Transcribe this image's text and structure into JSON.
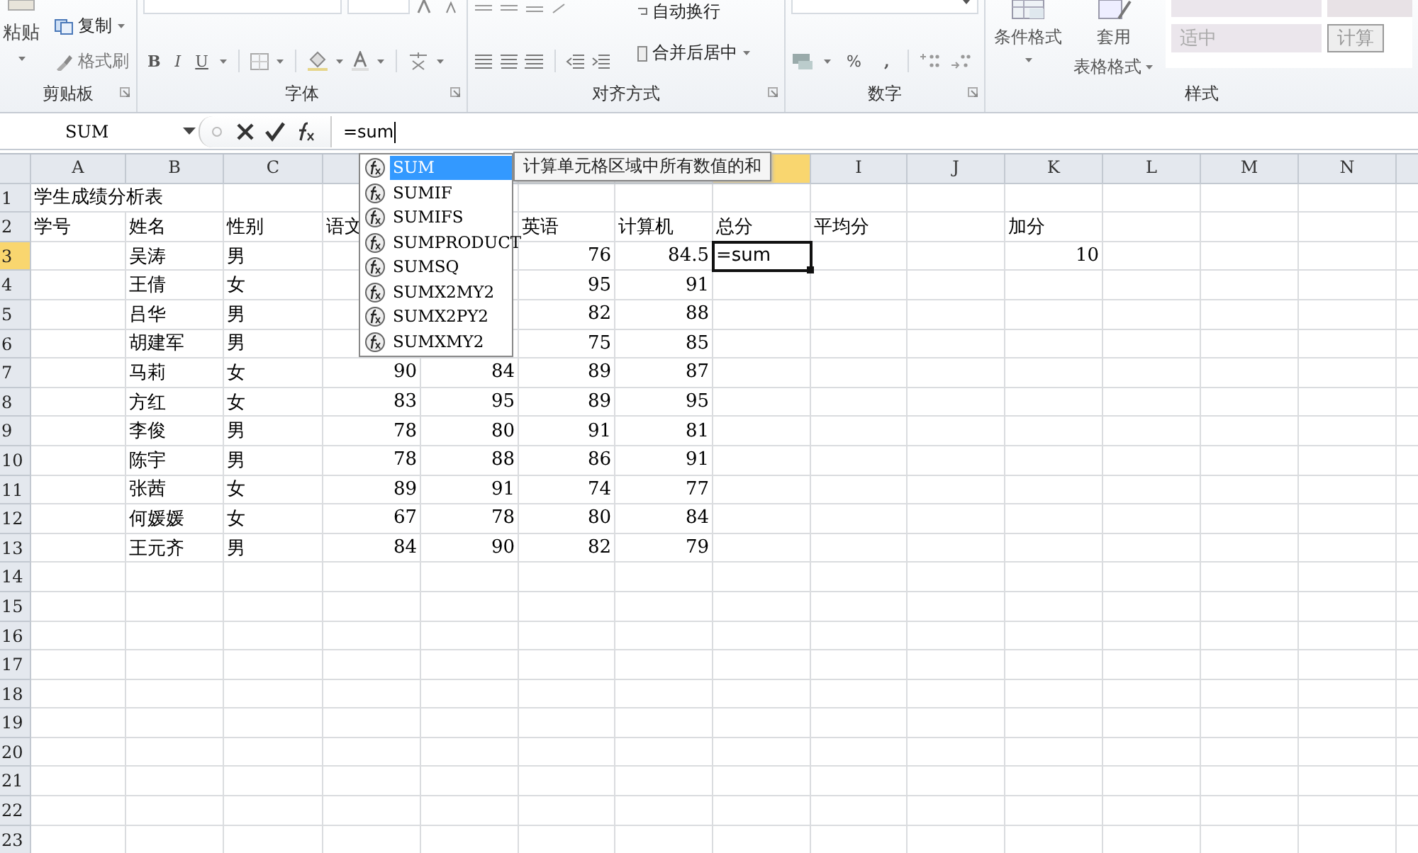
{
  "ribbon": {
    "clipboard": {
      "paste": "粘贴",
      "copy": "复制",
      "format_painter": "格式刷",
      "label": "剪贴板"
    },
    "font": {
      "bold": "B",
      "italic": "I",
      "underline": "U",
      "label": "字体"
    },
    "alignment": {
      "wrap_text": "自动换行",
      "merge_center": "合并后居中",
      "label": "对齐方式"
    },
    "number": {
      "percent": "%",
      "comma": ",",
      "label": "数字"
    },
    "styles": {
      "conditional_format": "条件格式",
      "table_format": [
        "套用",
        "表格格式"
      ],
      "style_cells": [
        {
          "text": "适中",
          "kind": "neutral"
        },
        {
          "text": "计算",
          "kind": "calc"
        }
      ],
      "label": "样式"
    }
  },
  "formula_bar": {
    "name_box": "SUM",
    "formula": "=sum"
  },
  "columns": [
    {
      "label": "A",
      "selected": false
    },
    {
      "label": "B",
      "selected": false
    },
    {
      "label": "C",
      "selected": false
    },
    {
      "selected": false
    },
    {
      "selected": false
    },
    {
      "selected": false
    },
    {
      "selected": false
    },
    {
      "selected": true
    },
    {
      "label": "I",
      "selected": false
    },
    {
      "label": "J",
      "selected": false
    },
    {
      "label": "K",
      "selected": false
    },
    {
      "label": "L",
      "selected": false
    },
    {
      "label": "M",
      "selected": false
    },
    {
      "label": "N",
      "selected": false
    }
  ],
  "rows": [
    {
      "number": "1",
      "selected": false,
      "cells": {
        "a": {
          "text": "学生成绩分析表",
          "kind": "text",
          "selected": false
        }
      }
    },
    {
      "number": "2",
      "selected": false,
      "cells": {
        "a": {
          "text": "学号",
          "kind": "text",
          "selected": false
        },
        "b": {
          "text": "姓名",
          "kind": "text",
          "selected": false
        },
        "c": {
          "text": "性别",
          "kind": "text",
          "selected": false
        },
        "d": {
          "text": "语文",
          "kind": "text",
          "selected": false
        },
        "f": {
          "text": "英语",
          "kind": "text",
          "selected": false
        },
        "g": {
          "text": "计算机",
          "kind": "text",
          "selected": false
        },
        "h": {
          "text": "总分",
          "kind": "text",
          "selected": false
        },
        "i": {
          "text": "平均分",
          "kind": "text",
          "selected": false
        },
        "k": {
          "text": "加分",
          "kind": "text",
          "selected": false
        }
      }
    },
    {
      "number": "3",
      "selected": true,
      "cells": {
        "b": {
          "text": "吴涛",
          "kind": "text",
          "selected": false
        },
        "c": {
          "text": "男",
          "kind": "text",
          "selected": false
        },
        "f": {
          "text": "76",
          "kind": "number",
          "selected": false
        },
        "g": {
          "text": "84.5",
          "kind": "number",
          "selected": false
        },
        "h": {
          "text": "=sum",
          "kind": "text",
          "selected": true
        },
        "k": {
          "text": "10",
          "kind": "number",
          "selected": false
        }
      }
    },
    {
      "number": "4",
      "selected": false,
      "cells": {
        "b": {
          "text": "王倩",
          "kind": "text",
          "selected": false
        },
        "c": {
          "text": "女",
          "kind": "text",
          "selected": false
        },
        "f": {
          "text": "95",
          "kind": "number",
          "selected": false
        },
        "g": {
          "text": "91",
          "kind": "number",
          "selected": false
        }
      }
    },
    {
      "number": "5",
      "selected": false,
      "cells": {
        "b": {
          "text": "吕华",
          "kind": "text",
          "selected": false
        },
        "c": {
          "text": "男",
          "kind": "text",
          "selected": false
        },
        "f": {
          "text": "82",
          "kind": "number",
          "selected": false
        },
        "g": {
          "text": "88",
          "kind": "number",
          "selected": false
        }
      }
    },
    {
      "number": "6",
      "selected": false,
      "cells": {
        "b": {
          "text": "胡建军",
          "kind": "text",
          "selected": false
        },
        "c": {
          "text": "男",
          "kind": "text",
          "selected": false
        },
        "f": {
          "text": "75",
          "kind": "number",
          "selected": false
        },
        "g": {
          "text": "85",
          "kind": "number",
          "selected": false
        }
      }
    },
    {
      "number": "7",
      "selected": false,
      "cells": {
        "b": {
          "text": "马莉",
          "kind": "text",
          "selected": false
        },
        "c": {
          "text": "女",
          "kind": "text",
          "selected": false
        },
        "d": {
          "text": "90",
          "kind": "number",
          "selected": false
        },
        "e": {
          "text": "84",
          "kind": "number",
          "selected": false
        },
        "f": {
          "text": "89",
          "kind": "number",
          "selected": false
        },
        "g": {
          "text": "87",
          "kind": "number",
          "selected": false
        }
      }
    },
    {
      "number": "8",
      "selected": false,
      "cells": {
        "b": {
          "text": "方红",
          "kind": "text",
          "selected": false
        },
        "c": {
          "text": "女",
          "kind": "text",
          "selected": false
        },
        "d": {
          "text": "83",
          "kind": "number",
          "selected": false
        },
        "e": {
          "text": "95",
          "kind": "number",
          "selected": false
        },
        "f": {
          "text": "89",
          "kind": "number",
          "selected": false
        },
        "g": {
          "text": "95",
          "kind": "number",
          "selected": false
        }
      }
    },
    {
      "number": "9",
      "selected": false,
      "cells": {
        "b": {
          "text": "李俊",
          "kind": "text",
          "selected": false
        },
        "c": {
          "text": "男",
          "kind": "text",
          "selected": false
        },
        "d": {
          "text": "78",
          "kind": "number",
          "selected": false
        },
        "e": {
          "text": "80",
          "kind": "number",
          "selected": false
        },
        "f": {
          "text": "91",
          "kind": "number",
          "selected": false
        },
        "g": {
          "text": "81",
          "kind": "number",
          "selected": false
        }
      }
    },
    {
      "number": "10",
      "selected": false,
      "cells": {
        "b": {
          "text": "陈宇",
          "kind": "text",
          "selected": false
        },
        "c": {
          "text": "男",
          "kind": "text",
          "selected": false
        },
        "d": {
          "text": "78",
          "kind": "number",
          "selected": false
        },
        "e": {
          "text": "88",
          "kind": "number",
          "selected": false
        },
        "f": {
          "text": "86",
          "kind": "number",
          "selected": false
        },
        "g": {
          "text": "91",
          "kind": "number",
          "selected": false
        }
      }
    },
    {
      "number": "11",
      "selected": false,
      "cells": {
        "b": {
          "text": "张茜",
          "kind": "text",
          "selected": false
        },
        "c": {
          "text": "女",
          "kind": "text",
          "selected": false
        },
        "d": {
          "text": "89",
          "kind": "number",
          "selected": false
        },
        "e": {
          "text": "91",
          "kind": "number",
          "selected": false
        },
        "f": {
          "text": "74",
          "kind": "number",
          "selected": false
        },
        "g": {
          "text": "77",
          "kind": "number",
          "selected": false
        }
      }
    },
    {
      "number": "12",
      "selected": false,
      "cells": {
        "b": {
          "text": "何媛媛",
          "kind": "text",
          "selected": false
        },
        "c": {
          "text": "女",
          "kind": "text",
          "selected": false
        },
        "d": {
          "text": "67",
          "kind": "number",
          "selected": false
        },
        "e": {
          "text": "78",
          "kind": "number",
          "selected": false
        },
        "f": {
          "text": "80",
          "kind": "number",
          "selected": false
        },
        "g": {
          "text": "84",
          "kind": "number",
          "selected": false
        }
      }
    },
    {
      "number": "13",
      "selected": false,
      "cells": {
        "b": {
          "text": "王元齐",
          "kind": "text",
          "selected": false
        },
        "c": {
          "text": "男",
          "kind": "text",
          "selected": false
        },
        "d": {
          "text": "84",
          "kind": "number",
          "selected": false
        },
        "e": {
          "text": "90",
          "kind": "number",
          "selected": false
        },
        "f": {
          "text": "82",
          "kind": "number",
          "selected": false
        },
        "g": {
          "text": "79",
          "kind": "number",
          "selected": false
        }
      }
    },
    {
      "number": "14",
      "selected": false
    },
    {
      "number": "15",
      "selected": false
    },
    {
      "number": "16",
      "selected": false
    },
    {
      "number": "17",
      "selected": false
    },
    {
      "number": "18",
      "selected": false
    },
    {
      "number": "19",
      "selected": false
    },
    {
      "number": "20",
      "selected": false
    },
    {
      "number": "21",
      "selected": false
    },
    {
      "number": "22",
      "selected": false
    },
    {
      "number": "23",
      "selected": false
    }
  ],
  "autocomplete": {
    "items": [
      {
        "label": "SUM",
        "selected": true
      },
      {
        "label": "SUMIF",
        "selected": false
      },
      {
        "label": "SUMIFS",
        "selected": false
      },
      {
        "label": "SUMPRODUCT",
        "selected": false
      },
      {
        "label": "SUMSQ",
        "selected": false
      },
      {
        "label": "SUMX2MY2",
        "selected": false
      },
      {
        "label": "SUMX2PY2",
        "selected": false
      },
      {
        "label": "SUMXMY2",
        "selected": false
      }
    ],
    "tooltip": "计算单元格区域中所有数值的和"
  }
}
